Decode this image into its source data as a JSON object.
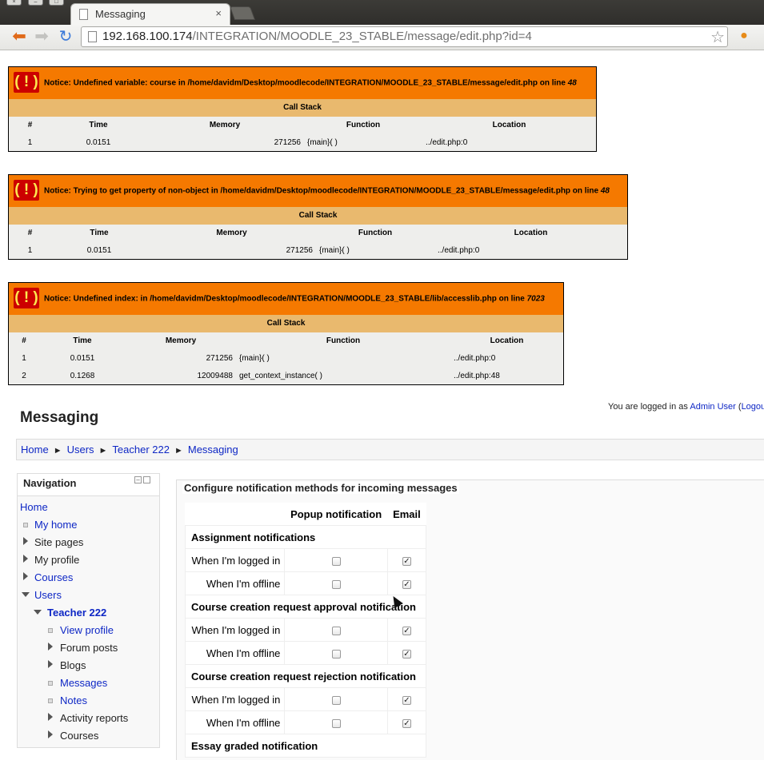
{
  "browser": {
    "tab_title": "Messaging",
    "tab_close": "×",
    "url_host": "192.168.100.174",
    "url_path": "/INTEGRATION/MOODLE_23_STABLE/message/edit.php?id=4"
  },
  "notices": [
    {
      "icon_text": "( ! )",
      "message": "Notice: Undefined variable: course in /home/davidm/Desktop/moodlecode/INTEGRATION/MOODLE_23_STABLE/message/edit.php on line ",
      "line": "48",
      "callstack_label": "Call Stack",
      "headers": [
        "#",
        "Time",
        "Memory",
        "Function",
        "Location"
      ],
      "rows": [
        {
          "num": "1",
          "time": "0.0151",
          "memory": "271256",
          "function": "{main}( )",
          "location": "../edit.php:0"
        }
      ]
    },
    {
      "icon_text": "( ! )",
      "message": "Notice: Trying to get property of non-object in /home/davidm/Desktop/moodlecode/INTEGRATION/MOODLE_23_STABLE/message/edit.php on line ",
      "line": "48",
      "callstack_label": "Call Stack",
      "headers": [
        "#",
        "Time",
        "Memory",
        "Function",
        "Location"
      ],
      "rows": [
        {
          "num": "1",
          "time": "0.0151",
          "memory": "271256",
          "function": "{main}( )",
          "location": "../edit.php:0"
        }
      ]
    },
    {
      "icon_text": "( ! )",
      "message": "Notice: Undefined index: in /home/davidm/Desktop/moodlecode/INTEGRATION/MOODLE_23_STABLE/lib/accesslib.php on line ",
      "line": "7023",
      "callstack_label": "Call Stack",
      "headers": [
        "#",
        "Time",
        "Memory",
        "Function",
        "Location"
      ],
      "rows": [
        {
          "num": "1",
          "time": "0.0151",
          "memory": "271256",
          "function": "{main}( )",
          "location": "../edit.php:0"
        },
        {
          "num": "2",
          "time": "0.1268",
          "memory": "12009488",
          "function": "get_context_instance( )",
          "location": "../edit.php:48"
        }
      ]
    }
  ],
  "header": {
    "login_prefix": "You are logged in as ",
    "user_name": "Admin User",
    "logout_paren": " (",
    "logout_label": "Logout",
    "page_title": "Messaging"
  },
  "breadcrumb": {
    "items": [
      "Home",
      "Users",
      "Teacher 222",
      "Messaging"
    ],
    "separator": "►"
  },
  "navigation": {
    "title": "Navigation",
    "home": "Home",
    "my_home": "My home",
    "site_pages": "Site pages",
    "my_profile": "My profile",
    "courses": "Courses",
    "users": "Users",
    "teacher": "Teacher 222",
    "view_profile": "View profile",
    "forum_posts": "Forum posts",
    "blogs": "Blogs",
    "messages": "Messages",
    "notes": "Notes",
    "activity_reports": "Activity reports",
    "teacher_courses": "Courses"
  },
  "preferences": {
    "legend": "Configure notification methods for incoming messages",
    "col_popup": "Popup notification",
    "col_email": "Email",
    "logged_in_label": "When I'm logged in",
    "offline_label": "When I'm offline",
    "groups": [
      {
        "name": "Assignment notifications",
        "logged_in": {
          "popup": false,
          "email": true
        },
        "offline": {
          "popup": false,
          "email": true
        }
      },
      {
        "name": "Course creation request approval notification",
        "logged_in": {
          "popup": false,
          "email": true
        },
        "offline": {
          "popup": false,
          "email": true
        }
      },
      {
        "name": "Course creation request rejection notification",
        "logged_in": {
          "popup": false,
          "email": true
        },
        "offline": {
          "popup": false,
          "email": true
        }
      },
      {
        "name": "Essay graded notification"
      }
    ]
  }
}
